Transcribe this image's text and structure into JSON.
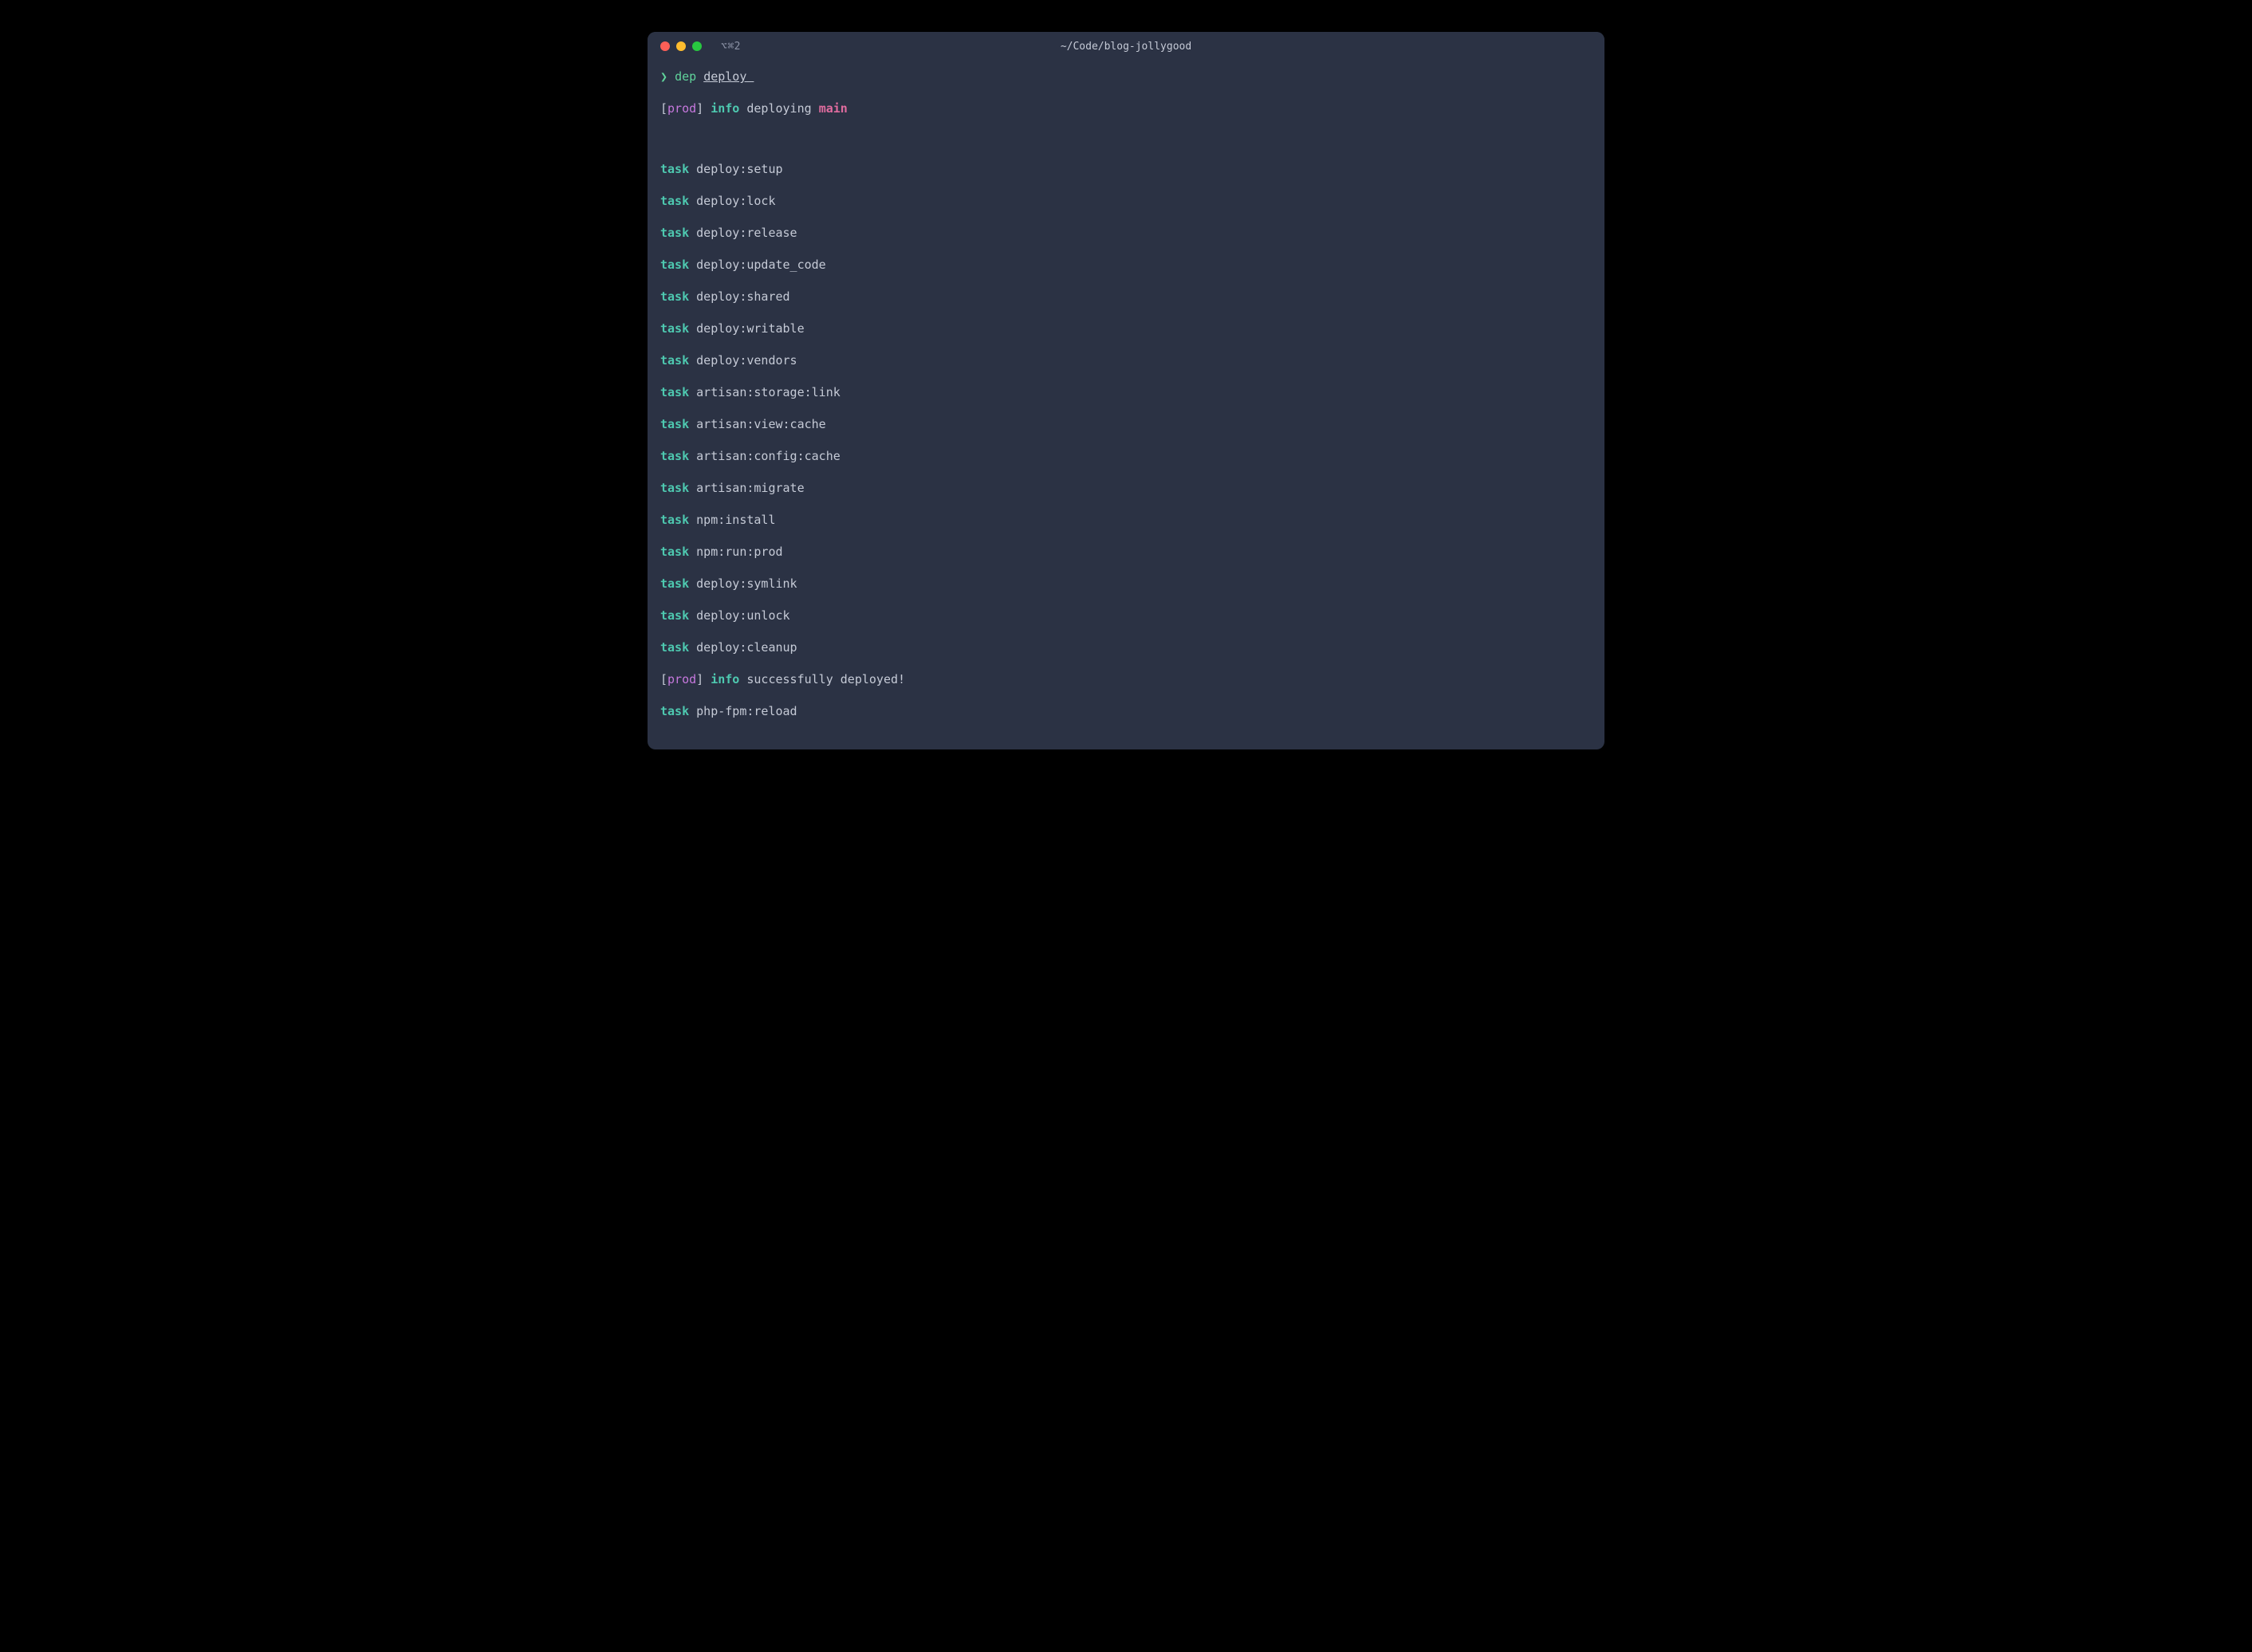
{
  "titlebar": {
    "tab_label": "⌥⌘2",
    "title": "~/Code/blog-jollygood"
  },
  "prompt": {
    "char": "❯",
    "command": "dep",
    "arg": "deploy "
  },
  "status_line_1": {
    "bracket_open": "[",
    "host": "prod",
    "bracket_close": "]",
    "info_label": "info",
    "text": "deploying",
    "branch": "main"
  },
  "tasks": [
    {
      "keyword": "task",
      "name": "deploy:setup"
    },
    {
      "keyword": "task",
      "name": "deploy:lock"
    },
    {
      "keyword": "task",
      "name": "deploy:release"
    },
    {
      "keyword": "task",
      "name": "deploy:update_code"
    },
    {
      "keyword": "task",
      "name": "deploy:shared"
    },
    {
      "keyword": "task",
      "name": "deploy:writable"
    },
    {
      "keyword": "task",
      "name": "deploy:vendors"
    },
    {
      "keyword": "task",
      "name": "artisan:storage:link"
    },
    {
      "keyword": "task",
      "name": "artisan:view:cache"
    },
    {
      "keyword": "task",
      "name": "artisan:config:cache"
    },
    {
      "keyword": "task",
      "name": "artisan:migrate"
    },
    {
      "keyword": "task",
      "name": "npm:install"
    },
    {
      "keyword": "task",
      "name": "npm:run:prod"
    },
    {
      "keyword": "task",
      "name": "deploy:symlink"
    },
    {
      "keyword": "task",
      "name": "deploy:unlock"
    },
    {
      "keyword": "task",
      "name": "deploy:cleanup"
    }
  ],
  "status_line_2": {
    "bracket_open": "[",
    "host": "prod",
    "bracket_close": "]",
    "info_label": "info",
    "text": "successfully deployed!"
  },
  "final_task": {
    "keyword": "task",
    "name": "php-fpm:reload"
  }
}
